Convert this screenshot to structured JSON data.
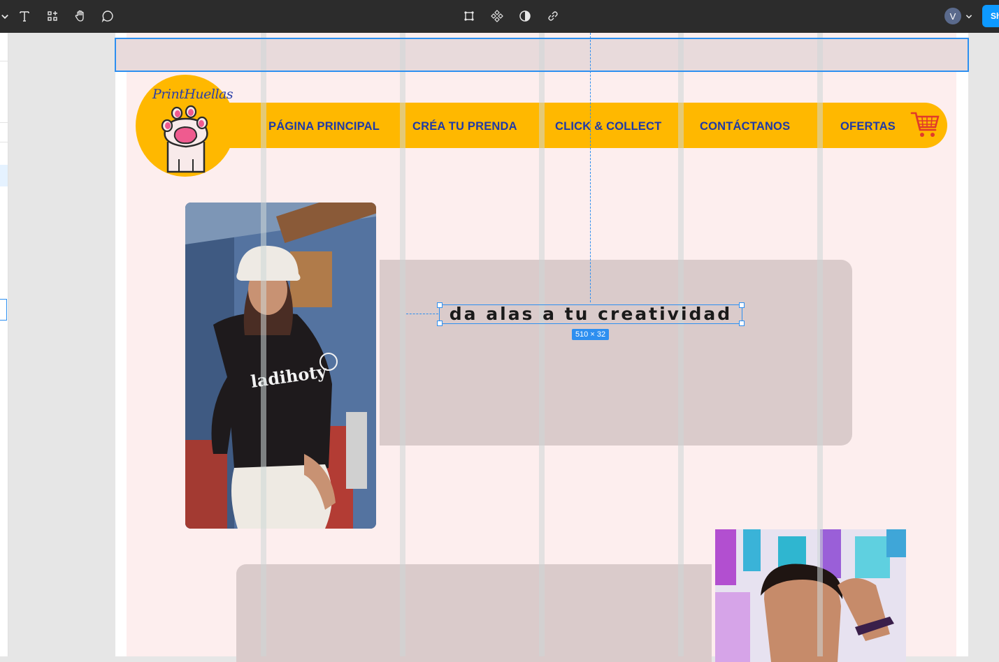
{
  "toolbar": {
    "tools": [
      "text-tool",
      "components-tool",
      "hand-tool",
      "comment-tool"
    ],
    "center_tools": [
      "frame-tool",
      "component-tool",
      "contrast-tool",
      "link-tool"
    ],
    "avatar_initial": "V",
    "share_label": "Sh"
  },
  "site": {
    "logo_text": "PrintHuellas",
    "nav": [
      {
        "label": "PÁGINA PRINCIPAL"
      },
      {
        "label": "CRÉA TU PRENDA"
      },
      {
        "label": "CLICK & COLLECT"
      },
      {
        "label": "CONTÁCTANOS"
      },
      {
        "label": "OFERTAS"
      }
    ],
    "headline": "da alas a tu creatividad"
  },
  "selection": {
    "dimensions": "510 × 32"
  },
  "colors": {
    "toolbar_bg": "#2c2c2c",
    "page_bg": "#fdeeee",
    "nav_yellow": "#ffb800",
    "nav_text": "#1e3aa8",
    "card_gray": "#dacbcb",
    "selection_blue": "#2d8ff0"
  }
}
